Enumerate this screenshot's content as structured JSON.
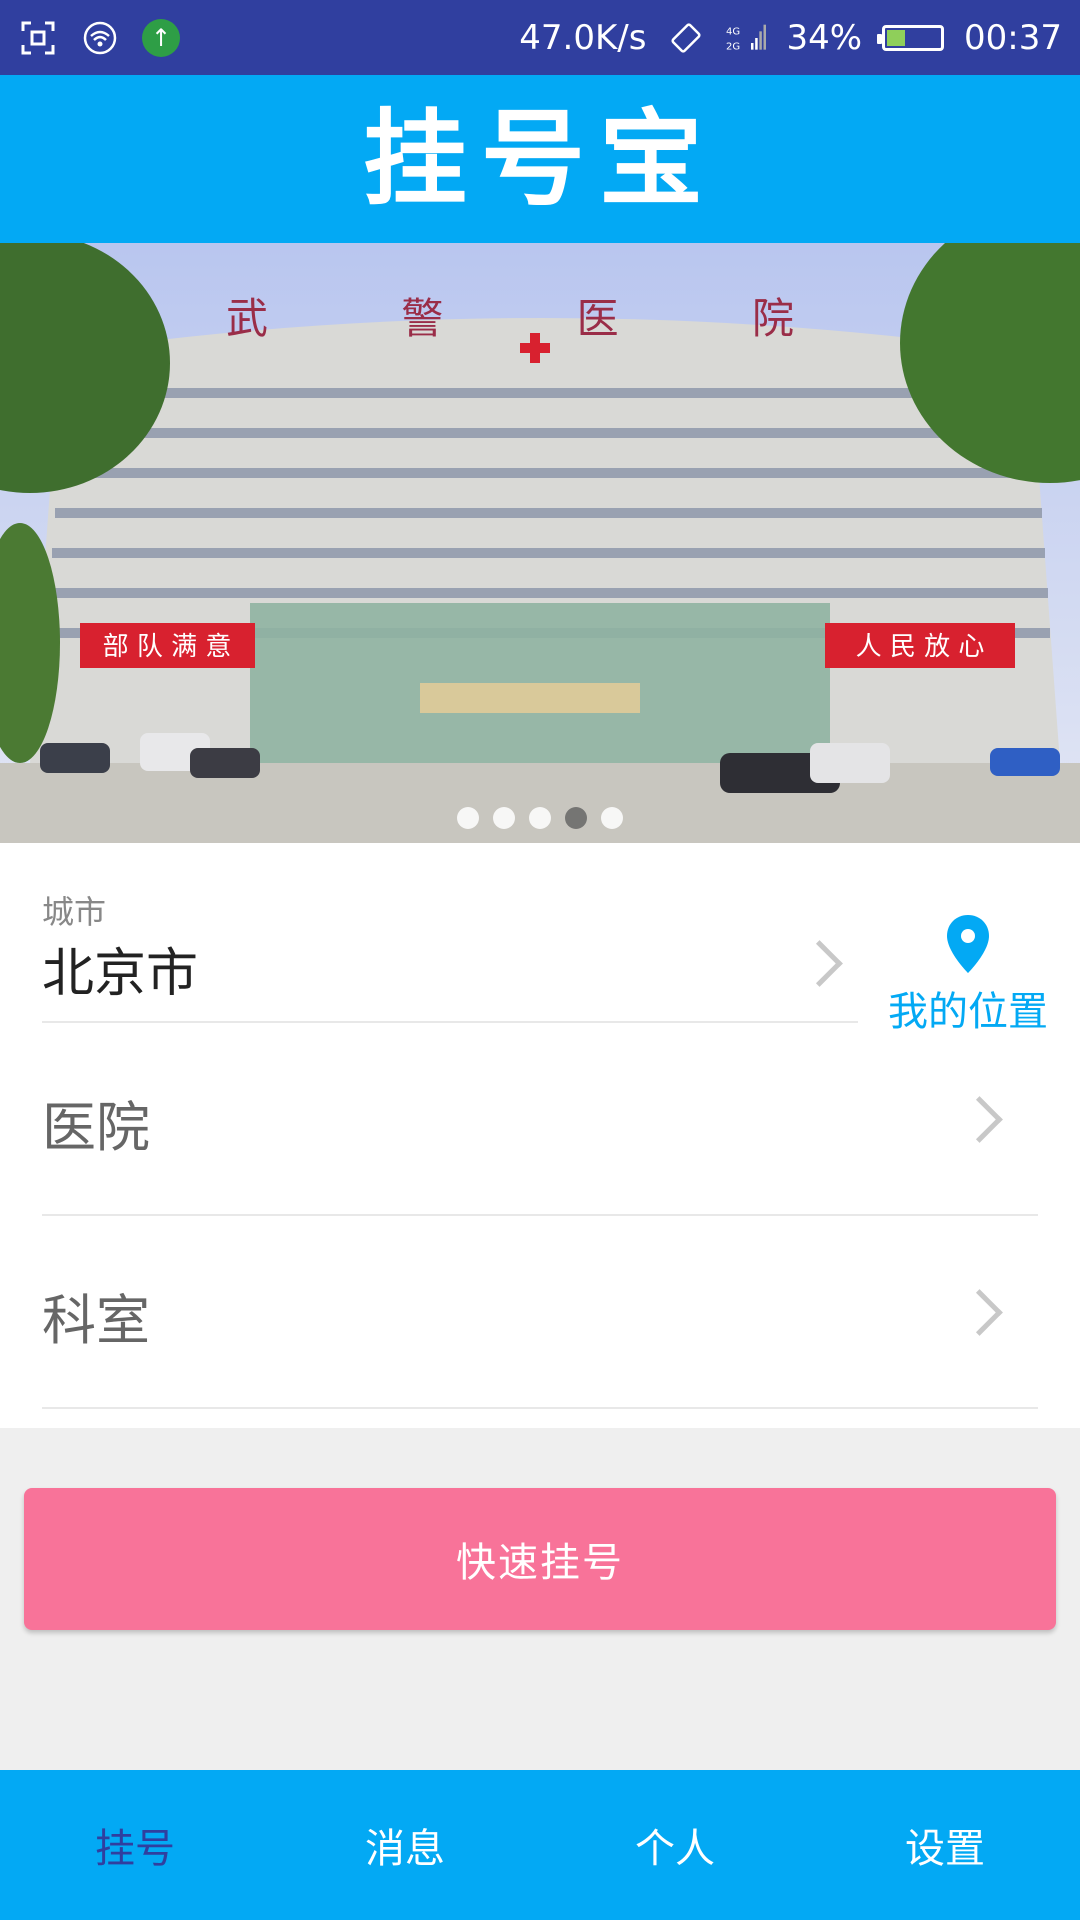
{
  "status_bar": {
    "speed": "47.0K/s",
    "network": "4G 2G",
    "battery_text": "34%",
    "battery_level": 0.34,
    "time": "00:37"
  },
  "header": {
    "title": "挂号宝"
  },
  "banner": {
    "image_text": {
      "hospital_name": "武 警 医 院",
      "left_banner": "部 队 满 意",
      "right_banner": "人 民 放 心"
    },
    "dot_count": 5,
    "active_index": 3
  },
  "form": {
    "city_label": "城市",
    "city_value": "北京市",
    "location_label": "我的位置",
    "hospital_placeholder": "医院",
    "department_placeholder": "科室"
  },
  "quick_button": {
    "label": "快速挂号"
  },
  "bottom_nav": {
    "items": [
      {
        "label": "挂号",
        "active": true
      },
      {
        "label": "消息",
        "active": false
      },
      {
        "label": "个人",
        "active": false
      },
      {
        "label": "设置",
        "active": false
      }
    ]
  },
  "colors": {
    "status_bar": "#303f9f",
    "primary": "#03a9f4",
    "accent_button": "#f87399",
    "active_nav": "#303f9f"
  }
}
